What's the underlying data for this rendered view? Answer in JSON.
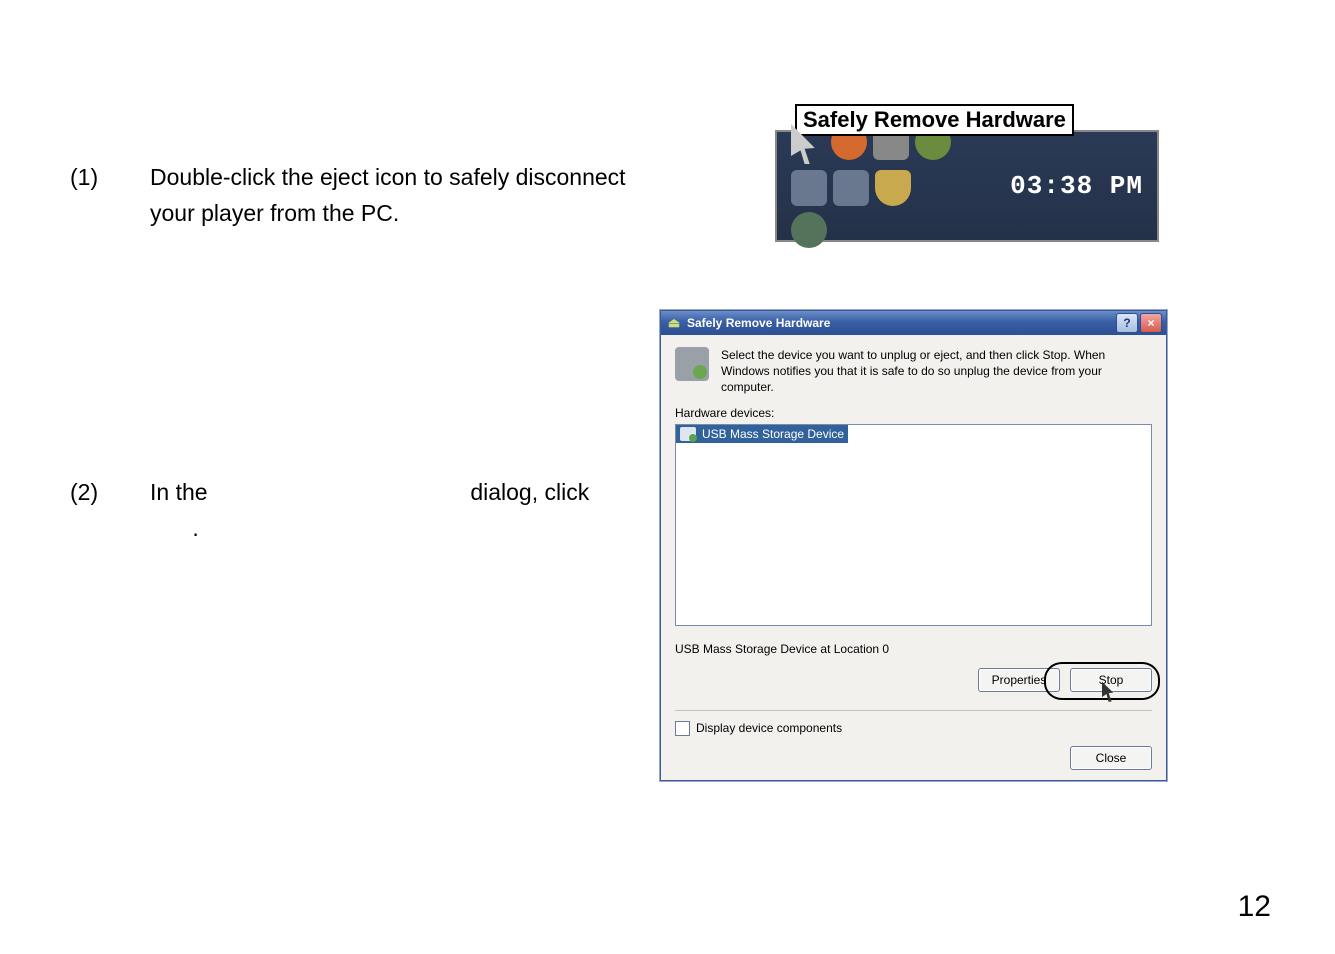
{
  "instructions": {
    "step1_num": "(1)",
    "step1_text": "Double-click the eject icon to safely disconnect your player from the PC.",
    "step2_num": "(2)",
    "step2_prefix": "In the",
    "step2_mid": " ",
    "step2_suffix": "dialog, click",
    "step2_tail": "."
  },
  "tray": {
    "tooltip": "Safely Remove Hardware",
    "clock": "03:38 PM"
  },
  "dialog": {
    "title": "Safely Remove Hardware",
    "help_glyph": "?",
    "close_glyph": "×",
    "description": "Select the device you want to unplug or eject, and then click Stop. When Windows notifies you that it is safe to do so unplug the device from your computer.",
    "list_label": "Hardware devices:",
    "device_item": "USB Mass Storage Device",
    "status_line": "USB Mass Storage Device at Location 0",
    "btn_properties": "Properties",
    "btn_stop": "Stop",
    "chk_label": "Display device components",
    "btn_close": "Close"
  },
  "page_number": "12"
}
